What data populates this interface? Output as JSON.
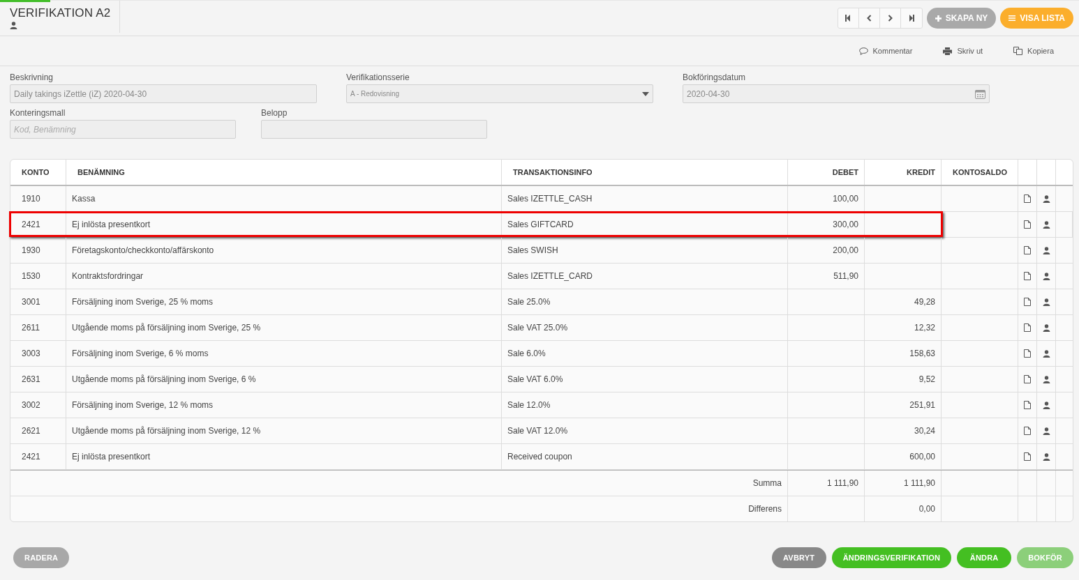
{
  "header": {
    "title": "VERIFIKATION A2",
    "buttons": [
      {
        "label": "SKAPA NY",
        "kind": "secondary"
      },
      {
        "label": "VISA LISTA",
        "kind": "primary"
      }
    ]
  },
  "actions": [
    {
      "label": "Kommentar",
      "kind": "comment"
    },
    {
      "label": "Skriv ut",
      "kind": "print"
    },
    {
      "label": "Kopiera",
      "kind": "copy"
    }
  ],
  "form": {
    "rows": [
      [
        {
          "label": "Beskrivning",
          "value": "Daily takings iZettle (iZ) 2020-04-30",
          "kind": "text"
        },
        {
          "label": "Verifikationsserie",
          "value": "A - Redovisning",
          "kind": "select"
        },
        {
          "label": "Bokföringsdatum",
          "value": "2020-04-30",
          "kind": "date"
        }
      ],
      [
        {
          "label": "Konteringsmall",
          "placeholder": "Kod, Benämning",
          "kind": "text"
        },
        {
          "label": "Belopp",
          "kind": "text"
        }
      ]
    ]
  },
  "table": {
    "columns": [
      "KONTO",
      "BENÄMNING",
      "TRANSAKTIONSINFO",
      "DEBET",
      "KREDIT",
      "KONTOSALDO"
    ],
    "rows": [
      {
        "konto": "1910",
        "benamning": "Kassa",
        "info": "Sales IZETTLE_CASH",
        "debet": "100,00",
        "highlighted": false
      },
      {
        "konto": "2421",
        "benamning": "Ej inlösta presentkort",
        "info": "Sales GIFTCARD",
        "debet": "300,00",
        "highlighted": true
      },
      {
        "konto": "1930",
        "benamning": "Företagskonto/checkkonto/affärskonto",
        "info": "Sales SWISH",
        "debet": "200,00",
        "highlighted": false
      },
      {
        "konto": "1530",
        "benamning": "Kontraktsfordringar",
        "info": "Sales IZETTLE_CARD",
        "debet": "511,90",
        "highlighted": false
      },
      {
        "konto": "3001",
        "benamning": "Försäljning inom Sverige, 25 % moms",
        "info": "Sale 25.0%",
        "kredit": "49,28",
        "highlighted": false
      },
      {
        "konto": "2611",
        "benamning": "Utgående moms på försäljning inom Sverige, 25 %",
        "info": "Sale VAT 25.0%",
        "kredit": "12,32",
        "highlighted": false
      },
      {
        "konto": "3003",
        "benamning": "Försäljning inom Sverige, 6 % moms",
        "info": "Sale 6.0%",
        "kredit": "158,63",
        "highlighted": false
      },
      {
        "konto": "2631",
        "benamning": "Utgående moms på försäljning inom Sverige, 6 %",
        "info": "Sale VAT 6.0%",
        "kredit": "9,52",
        "highlighted": false
      },
      {
        "konto": "3002",
        "benamning": "Försäljning inom Sverige, 12 % moms",
        "info": "Sale 12.0%",
        "kredit": "251,91",
        "highlighted": false
      },
      {
        "konto": "2621",
        "benamning": "Utgående moms på försäljning inom Sverige, 12 %",
        "info": "Sale VAT 12.0%",
        "kredit": "30,24",
        "highlighted": false
      },
      {
        "konto": "2421",
        "benamning": "Ej inlösta presentkort",
        "info": "Received coupon",
        "kredit": "600,00",
        "highlighted": false
      }
    ],
    "totals": [
      {
        "label": "Summa",
        "debet": "1 111,90",
        "kredit": "1 111,90"
      },
      {
        "label": "Differens",
        "kredit": "0,00"
      }
    ]
  },
  "footer": {
    "delete_button": {
      "label": "RADERA",
      "kind": "neutral",
      "disabled": true
    },
    "buttons": [
      {
        "label": "AVBRYT",
        "kind": "neutral",
        "disabled": false
      },
      {
        "label": "ÄNDRINGSVERIFIKATION",
        "kind": "success",
        "disabled": false
      },
      {
        "label": "ÄNDRA",
        "kind": "success",
        "disabled": false
      },
      {
        "label": "BOKFÖR",
        "kind": "success",
        "disabled": true
      }
    ]
  }
}
